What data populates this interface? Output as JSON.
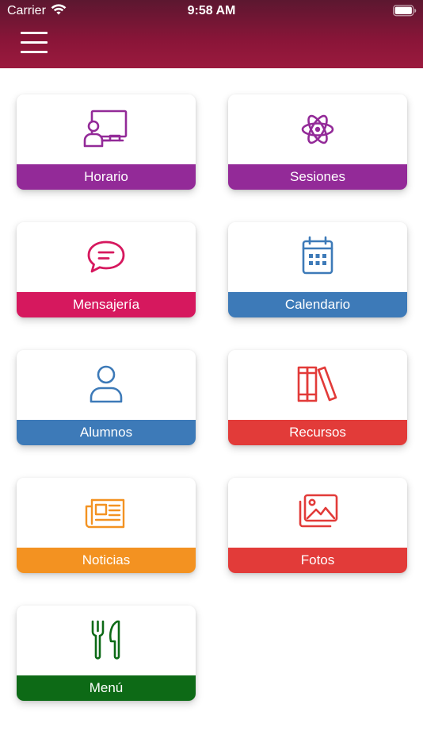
{
  "status_bar": {
    "carrier": "Carrier",
    "time": "9:58 AM"
  },
  "header": {
    "menu_icon": "hamburger-menu-icon"
  },
  "tiles": [
    {
      "label": "Horario",
      "icon": "teacher-board-icon",
      "color": "#932a98"
    },
    {
      "label": "Sesiones",
      "icon": "atom-icon",
      "color": "#932a98"
    },
    {
      "label": "Mensajería",
      "icon": "chat-bubble-icon",
      "color": "#d6185e"
    },
    {
      "label": "Calendario",
      "icon": "calendar-icon",
      "color": "#3d7ab8"
    },
    {
      "label": "Alumnos",
      "icon": "user-icon",
      "color": "#3d7ab8"
    },
    {
      "label": "Recursos",
      "icon": "books-icon",
      "color": "#e23b39"
    },
    {
      "label": "Noticias",
      "icon": "newspaper-icon",
      "color": "#f39221"
    },
    {
      "label": "Fotos",
      "icon": "photos-icon",
      "color": "#e23b39"
    },
    {
      "label": "Menú",
      "icon": "cutlery-icon",
      "color": "#0d6a16"
    }
  ]
}
